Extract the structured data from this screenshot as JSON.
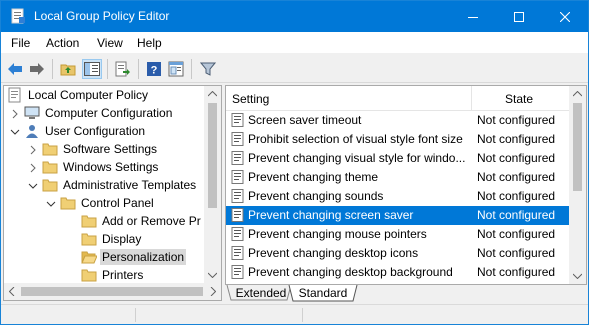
{
  "window": {
    "title": "Local Group Policy Editor",
    "accent": "#0078d7"
  },
  "menubar": {
    "items": [
      "File",
      "Action",
      "View",
      "Help"
    ]
  },
  "toolbar": {
    "icons": [
      "back-arrow-icon",
      "forward-arrow-icon",
      "up-folder-icon",
      "show-hide-tree-icon",
      "export-list-icon",
      "help-icon",
      "properties-icon",
      "filter-icon"
    ]
  },
  "tree": {
    "items": [
      {
        "label": "Local Computer Policy",
        "icon": "policy-icon"
      },
      {
        "label": "Computer Configuration",
        "icon": "computer-icon"
      },
      {
        "label": "User Configuration",
        "icon": "user-icon"
      },
      {
        "label": "Software Settings",
        "icon": "folder-icon"
      },
      {
        "label": "Windows Settings",
        "icon": "folder-icon"
      },
      {
        "label": "Administrative Templates",
        "icon": "folder-icon"
      },
      {
        "label": "Control Panel",
        "icon": "folder-icon"
      },
      {
        "label": "Add or Remove Pr",
        "icon": "folder-icon"
      },
      {
        "label": "Display",
        "icon": "folder-icon"
      },
      {
        "label": "Personalization",
        "icon": "folder-icon"
      },
      {
        "label": "Printers",
        "icon": "folder-icon"
      }
    ],
    "selected": "Personalization"
  },
  "list": {
    "columns": {
      "setting": "Setting",
      "state": "State"
    },
    "rows": [
      {
        "name": "Screen saver timeout",
        "state": "Not configured"
      },
      {
        "name": "Prohibit selection of visual style font size",
        "state": "Not configured"
      },
      {
        "name": "Prevent changing visual style for windo...",
        "state": "Not configured"
      },
      {
        "name": "Prevent changing theme",
        "state": "Not configured"
      },
      {
        "name": "Prevent changing sounds",
        "state": "Not configured"
      },
      {
        "name": "Prevent changing screen saver",
        "state": "Not configured"
      },
      {
        "name": "Prevent changing mouse pointers",
        "state": "Not configured"
      },
      {
        "name": "Prevent changing desktop icons",
        "state": "Not configured"
      },
      {
        "name": "Prevent changing desktop background",
        "state": "Not configured"
      }
    ],
    "selected_row": "Prevent changing screen saver",
    "selected_color": "#0078d7"
  },
  "tabs": {
    "extended": "Extended",
    "standard": "Standard",
    "active": "Standard"
  }
}
